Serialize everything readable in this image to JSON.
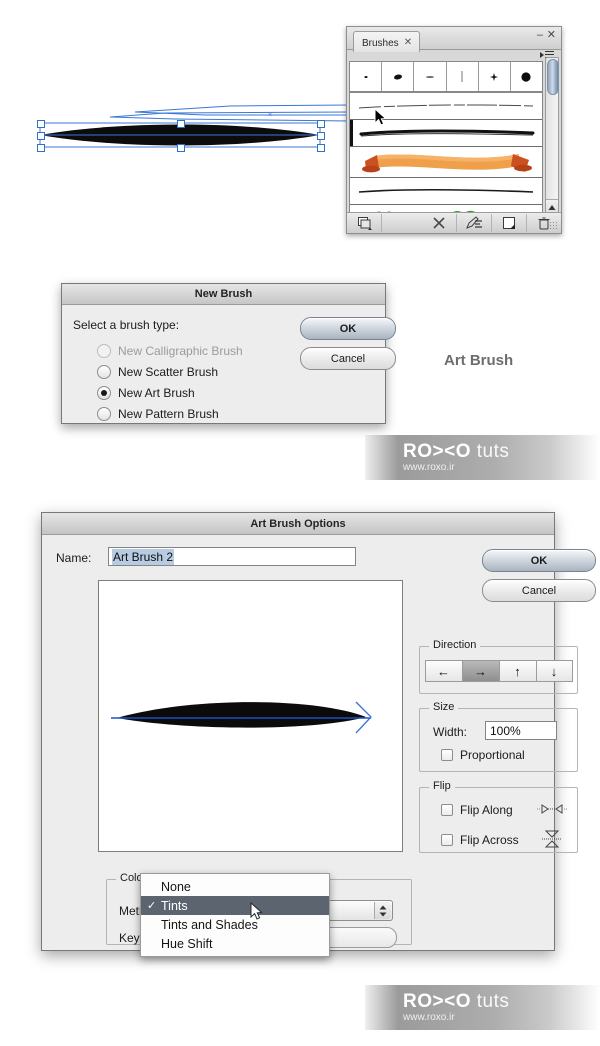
{
  "brushes_panel": {
    "tab_label": "Brushes",
    "tab_close_icon": "close-icon",
    "minimize_icon": "minimize-icon",
    "close_icon": "close-icon",
    "menu_icon": "panel-menu-icon",
    "swatches": [
      {
        "name": "brush-swatch-dot-tiny",
        "glyph": "·"
      },
      {
        "name": "brush-swatch-oval",
        "glyph": "●"
      },
      {
        "name": "brush-swatch-dash",
        "glyph": "–"
      },
      {
        "name": "brush-swatch-stroke",
        "glyph": "|"
      },
      {
        "name": "brush-swatch-star",
        "glyph": "✳"
      },
      {
        "name": "brush-swatch-circle",
        "glyph": "●"
      }
    ],
    "brush_rows": [
      {
        "name": "brush-row-thin-line",
        "type": "line"
      },
      {
        "name": "brush-row-charcoal",
        "type": "line-selected"
      },
      {
        "name": "brush-row-banner",
        "type": "ribbon"
      },
      {
        "name": "brush-row-tapered",
        "type": "line"
      },
      {
        "name": "brush-row-foliage",
        "type": "foliage"
      }
    ],
    "footer_buttons": [
      {
        "name": "brush-libraries-button",
        "icon": "libraries-icon"
      },
      {
        "name": "remove-brush-link-button",
        "icon": "x-icon"
      },
      {
        "name": "options-of-selected-object-button",
        "icon": "pencil-options-icon"
      },
      {
        "name": "new-brush-button",
        "icon": "new-page-icon"
      },
      {
        "name": "delete-brush-button",
        "icon": "trash-icon"
      }
    ],
    "scroll": {
      "up_icon": "triangle-up-icon",
      "down_icon": "triangle-down-icon"
    }
  },
  "new_brush_dialog": {
    "title": "New Brush",
    "prompt": "Select a brush type:",
    "options": [
      {
        "label": "New Calligraphic Brush",
        "selected": false,
        "disabled": true
      },
      {
        "label": "New Scatter Brush",
        "selected": false,
        "disabled": false
      },
      {
        "label": "New Art Brush",
        "selected": true,
        "disabled": false
      },
      {
        "label": "New Pattern Brush",
        "selected": false,
        "disabled": false
      }
    ],
    "ok_label": "OK",
    "cancel_label": "Cancel"
  },
  "annotation": {
    "art_brush_caption": "Art Brush"
  },
  "art_brush_options": {
    "title": "Art Brush Options",
    "name_label": "Name:",
    "name_value": "Art Brush 2",
    "ok_label": "OK",
    "cancel_label": "Cancel",
    "direction": {
      "legend": "Direction",
      "buttons": [
        {
          "name": "direction-left-button",
          "glyph": "←",
          "active": false
        },
        {
          "name": "direction-right-button",
          "glyph": "→",
          "active": true
        },
        {
          "name": "direction-up-button",
          "glyph": "↑",
          "active": false
        },
        {
          "name": "direction-down-button",
          "glyph": "↓",
          "active": false
        }
      ]
    },
    "size": {
      "legend": "Size",
      "width_label": "Width:",
      "width_value": "100%",
      "proportional_label": "Proportional",
      "proportional_checked": false
    },
    "flip": {
      "legend": "Flip",
      "flip_along_label": "Flip Along",
      "flip_along_checked": false,
      "flip_across_label": "Flip Across",
      "flip_across_checked": false
    },
    "colorization": {
      "legend": "Colorization",
      "method_label": "Method:",
      "method_value": "Tints",
      "key_color_label": "Key Color:",
      "menu_items": [
        {
          "label": "None",
          "checked": false,
          "highlighted": false
        },
        {
          "label": "Tints",
          "checked": true,
          "highlighted": true
        },
        {
          "label": "Tints and Shades",
          "checked": false,
          "highlighted": false
        },
        {
          "label": "Hue Shift",
          "checked": false,
          "highlighted": false
        }
      ],
      "check_glyph": "✓"
    }
  },
  "watermark": {
    "brand_bold": "RO><O",
    "brand_light": " tuts",
    "url": "www.roxo.ir"
  },
  "colors": {
    "selection_blue": "#2f6fd0",
    "menu_highlight": "#5c6470",
    "dialog_bg": "#ededed",
    "ribbon_orange": "#f0a04b",
    "ribbon_dark": "#cd5020"
  }
}
